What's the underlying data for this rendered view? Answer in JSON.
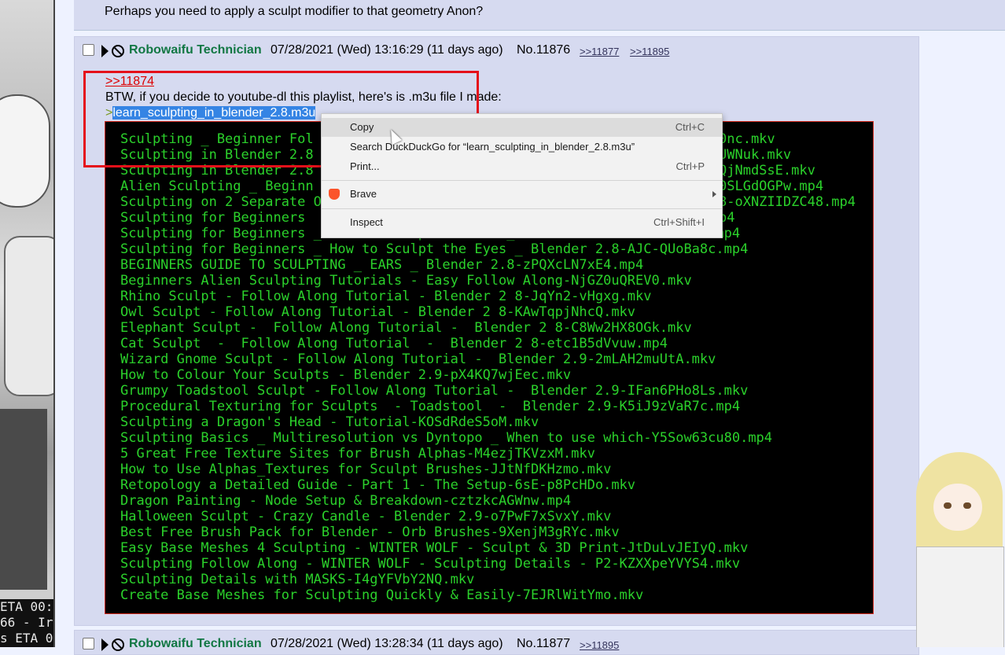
{
  "terminal": {
    "lines": [
      "ETA 00:",
      "66 - Ir",
      "s ETA 0"
    ]
  },
  "prev_post": {
    "text": "Perhaps you need to apply a sculpt modifier to that geometry Anon?"
  },
  "post": {
    "name": "Robowaifu Technician",
    "date": "07/28/2021 (Wed) 13:16:29 (11 days ago)",
    "number": "No.11876",
    "backlinks": [
      ">>11877",
      ">>11895"
    ],
    "quote_link": ">>11874",
    "text_line1": "BTW, if you decide to youtube-dl this playlist, here's is .m3u file I made:",
    "greentext_prefix": ">",
    "filename": "learn_sculpting_in_blender_2.8.m3u",
    "code_lines": [
      "Sculpting _ Beginner Fol",
      "Sculpting in Blender 2.8",
      "Sculpting in Blender 2.8",
      "Alien Sculpting _ Beginn",
      "Sculpting on 2 Separate O",
      "Sculpting for Beginners",
      "Sculpting for Beginners _ How to Sculpt the Nose_ Blender 2.8-wk5t6xkPf8A.mp4",
      "Sculpting for Beginners _ How to Sculpt the Eyes _ Blender 2.8-AJC-QUoBa8c.mp4",
      "BEGINNERS GUIDE TO SCULPTING _ EARS _ Blender 2.8-zPQXcLN7xE4.mp4",
      "Beginners Alien Sculpting Tutorials - Easy Follow Along-NjGZ0uQREV0.mkv",
      "Rhino Sculpt - Follow Along Tutorial - Blender 2 8-JqYn2-vHgxg.mkv",
      "Owl Sculpt - Follow Along Tutorial - Blender 2 8-KAwTqpjNhcQ.mkv",
      "Elephant Sculpt -  Follow Along Tutorial -  Blender 2 8-C8Ww2HX8OGk.mkv",
      "Cat Sculpt  -  Follow Along Tutorial  -  Blender 2 8-etc1B5dVvuw.mp4",
      "Wizard Gnome Sculpt - Follow Along Tutorial -  Blender 2.9-2mLAH2muUtA.mkv",
      "How to Colour Your Sculpts - Blender 2.9-pX4KQ7wjEec.mkv",
      "Grumpy Toadstool Sculpt - Follow Along Tutorial -  Blender 2.9-IFan6PHo8Ls.mkv",
      "Procedural Texturing for Sculpts  - Toadstool  -  Blender 2.9-K5iJ9zVaR7c.mp4",
      "Sculpting a Dragon's Head - Tutorial-KOSdRdeS5oM.mkv",
      "Sculpting Basics _ Multiresolution vs Dyntopo _ When to use which-Y5Sow63cu80.mp4",
      "5 Great Free Texture Sites for Brush Alphas-M4ezjTKVzxM.mkv",
      "How to Use Alphas_Textures for Sculpt Brushes-JJtNfDKHzmo.mkv",
      "Retopology a Detailed Guide - Part 1 - The Setup-6sE-p8PcHDo.mkv",
      "Dragon Painting - Node Setup & Breakdown-cztzkcAGWnw.mp4",
      "Halloween Sculpt - Crazy Candle - Blender 2.9-o7PwF7xSvxY.mkv",
      "Best Free Brush Pack for Blender - Orb Brushes-9XenjM3gRYc.mkv",
      "Easy Base Meshes 4 Sculpting - WINTER WOLF - Sculpt & 3D Print-JtDuLvJEIyQ.mkv",
      "Sculpting Follow Along - WINTER WOLF - Sculpting Details - P2-KZXXpeYVYS4.mkv",
      "Sculpting Details with MASKS-I4gYFVbY2NQ.mkv",
      "Create Base Meshes for Sculpting Quickly & Easily-7EJRlWitYmo.mkv"
    ],
    "code_tails": [
      "0nc.mkv",
      "UWNuk.mkv",
      "QjNmdSsE.mkv",
      "0SLGdOGPw.mp4",
      "8-oXNZIIDZC48.mp4",
      "p4"
    ]
  },
  "next_post": {
    "name": "Robowaifu Technician",
    "date": "07/28/2021 (Wed) 13:28:34 (11 days ago)",
    "number": "No.11877",
    "backlinks": [
      ">>11895"
    ]
  },
  "context_menu": {
    "items": [
      {
        "label": "Copy",
        "shortcut": "Ctrl+C"
      },
      {
        "label": "Search DuckDuckGo for “learn_sculpting_in_blender_2.8.m3u”",
        "shortcut": ""
      },
      {
        "label": "Print...",
        "shortcut": "Ctrl+P"
      },
      {
        "label": "Brave",
        "shortcut": ""
      },
      {
        "label": "Inspect",
        "shortcut": "Ctrl+Shift+I"
      }
    ]
  },
  "colors": {
    "post_bg": "#d6daf0",
    "name": "#117743",
    "quote": "#dd0000",
    "code_fg": "#2bd12b",
    "highlight": "#e5101a"
  }
}
